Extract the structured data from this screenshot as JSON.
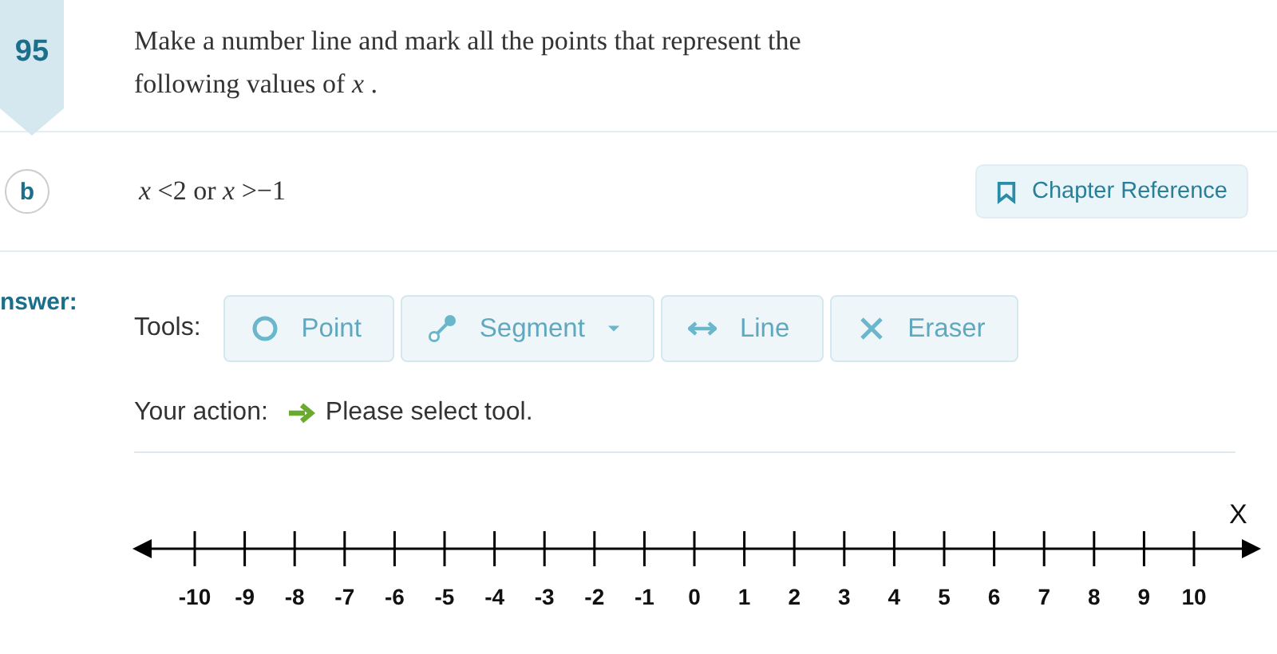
{
  "problem": {
    "number": "95",
    "prompt": "Make a number line and mark all the points that represent the following values of *x* ."
  },
  "part": {
    "letter": "b",
    "expression": "*x* <2 or *x* >−1"
  },
  "chapter_button": {
    "label": "Chapter Reference"
  },
  "answer": {
    "label": "nswer:"
  },
  "tools": {
    "label": "Tools:",
    "items": [
      {
        "kind": "point",
        "label": "Point",
        "dropdown": false
      },
      {
        "kind": "segment",
        "label": "Segment",
        "dropdown": true
      },
      {
        "kind": "line",
        "label": "Line",
        "dropdown": false
      },
      {
        "kind": "eraser",
        "label": "Eraser",
        "dropdown": false
      }
    ]
  },
  "action": {
    "label": "Your action:",
    "message": "Please select tool."
  },
  "number_line": {
    "axis_label": "X",
    "ticks": [
      "-10",
      "-9",
      "-8",
      "-7",
      "-6",
      "-5",
      "-4",
      "-3",
      "-2",
      "-1",
      "0",
      "1",
      "2",
      "3",
      "4",
      "5",
      "6",
      "7",
      "8",
      "9",
      "10"
    ]
  }
}
